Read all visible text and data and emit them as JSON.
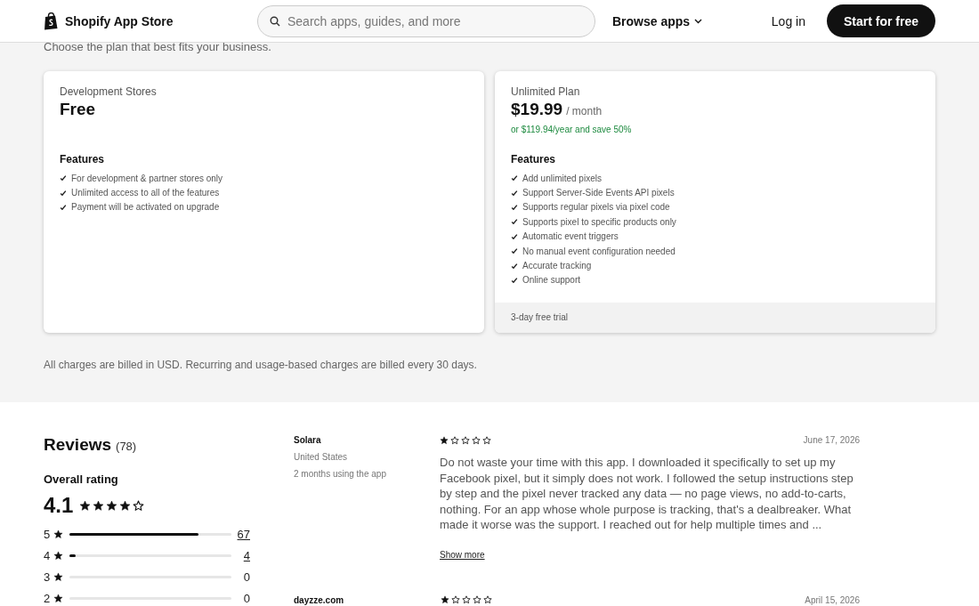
{
  "header": {
    "brand": "Shopify App Store",
    "search": {
      "placeholder": "Search apps, guides, and more"
    },
    "browse": "Browse apps",
    "login": "Log in",
    "cta": "Start for free"
  },
  "plans_intro": "Choose the plan that best fits your business.",
  "plans": [
    {
      "name": "Development Stores",
      "price": "Free",
      "features_title": "Features",
      "features": [
        "For development & partner stores only",
        "Unlimited access to all of the features",
        "Payment will be activated on upgrade"
      ]
    },
    {
      "name": "Unlimited Plan",
      "price": "$19.99",
      "period": "/ month",
      "annual": "or $119.94/year and save 50%",
      "features_title": "Features",
      "features": [
        "Add unlimited pixels",
        "Support Server-Side Events API pixels",
        "Supports regular pixels via pixel code",
        "Supports pixel to specific products only",
        "Automatic event triggers",
        "No manual event configuration needed",
        "Accurate tracking",
        "Online support"
      ],
      "footer": "3-day free trial"
    }
  ],
  "billing_note": "All charges are billed in USD. Recurring and usage-based charges are billed every 30 days.",
  "reviews": {
    "title": "Reviews",
    "count": "(78)",
    "overall_label": "Overall rating",
    "score": "4.1",
    "stars": 4,
    "distribution": [
      {
        "rating": "5",
        "level": 0.8,
        "count": "67",
        "linked": true
      },
      {
        "rating": "4",
        "level": 0.04,
        "count": "4",
        "linked": true
      },
      {
        "rating": "3",
        "level": 0,
        "count": "0",
        "linked": false
      },
      {
        "rating": "2",
        "level": 0,
        "count": "0",
        "linked": false
      }
    ],
    "items": [
      {
        "author": "Solara",
        "location": "United States",
        "duration": "2 months using the app",
        "stars": 1,
        "date": "June 17, 2026",
        "body": "Do not waste your time with this app. I downloaded it specifically to set up my Facebook pixel, but it simply does not work. I followed the setup instructions step by step and the pixel never tracked any data — no page views, no add-to-carts, nothing. For an app whose whole purpose is tracking, that's a dealbreaker. What made it worse was the support. I reached out for help multiple times and ...",
        "more": "Show more"
      },
      {
        "author": "dayzze.com",
        "stars": 1,
        "date": "April 15, 2026"
      }
    ]
  }
}
